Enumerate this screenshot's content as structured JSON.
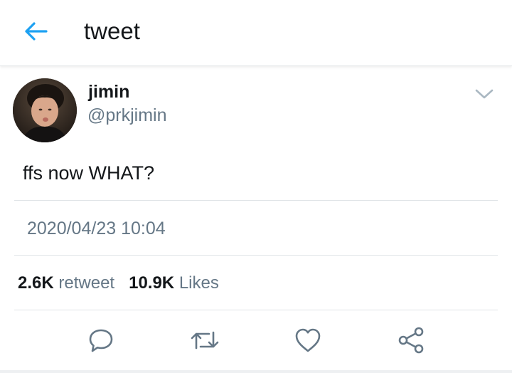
{
  "header": {
    "title": "tweet",
    "back_icon": "arrow-left-icon"
  },
  "tweet": {
    "author_name": "jimin",
    "author_handle": "@prkjimin",
    "text": "ffs now WHAT?",
    "timestamp": "2020/04/23 10:04",
    "menu_icon": "chevron-down-icon"
  },
  "stats": {
    "retweet_count": "2.6K",
    "retweet_label": "retweet",
    "likes_count": "10.9K",
    "likes_label": "Likes"
  },
  "actions": [
    {
      "name": "reply",
      "icon": "reply-icon"
    },
    {
      "name": "retweet",
      "icon": "retweet-icon"
    },
    {
      "name": "like",
      "icon": "heart-icon"
    },
    {
      "name": "share",
      "icon": "share-icon"
    }
  ],
  "colors": {
    "accent": "#1da1f2",
    "icon_gray": "#657786",
    "text": "#14171a",
    "divider": "#dfe3e6"
  }
}
